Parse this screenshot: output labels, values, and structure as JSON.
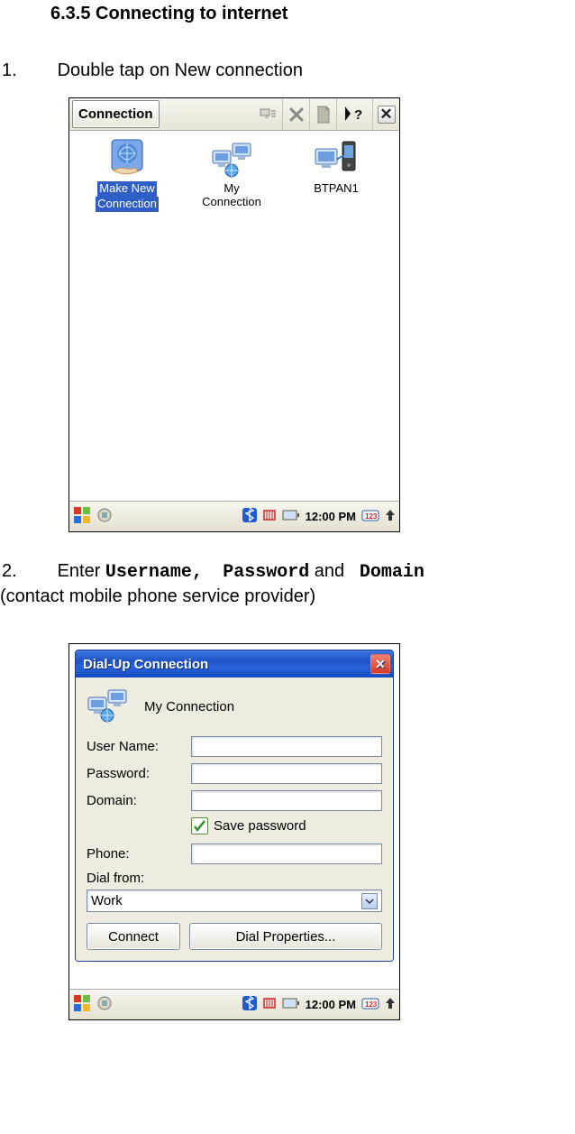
{
  "section_title": "6.3.5 Connecting to internet",
  "step1": {
    "number": "1.",
    "text": "Double tap on New connection"
  },
  "step2": {
    "number": "2.",
    "prefix": "Enter ",
    "kw1": "Username,",
    "kw2": "Password",
    "mid": " and ",
    "kw3": "Domain",
    "suffix": "(contact mobile phone service provider)"
  },
  "ss1": {
    "title": "Connection",
    "items": [
      {
        "label_line1": "Make New",
        "label_line2": "Connection"
      },
      {
        "label_line1": "My",
        "label_line2": "Connection"
      },
      {
        "label_line1": "BTPAN1",
        "label_line2": ""
      }
    ],
    "time": "12:00 PM"
  },
  "ss2": {
    "title": "Dial-Up Connection",
    "connection_name": "My Connection",
    "labels": {
      "username": "User Name:",
      "password": "Password:",
      "domain": "Domain:",
      "save_password": "Save password",
      "phone": "Phone:",
      "dial_from": "Dial from:"
    },
    "dial_from_value": "Work",
    "buttons": {
      "connect": "Connect",
      "dial_properties": "Dial Properties..."
    },
    "time": "12:00 PM"
  }
}
